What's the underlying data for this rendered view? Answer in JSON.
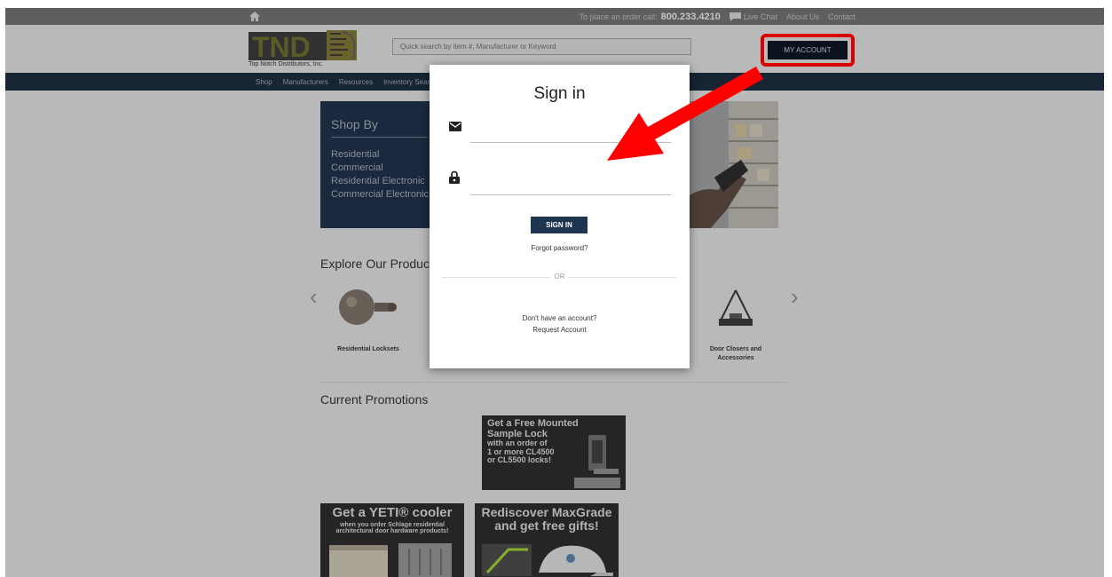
{
  "topbar": {
    "order_text": "To place an order call:",
    "phone": "800.233.4210",
    "live_chat": "Live Chat",
    "about": "About Us",
    "contact": "Contact"
  },
  "header": {
    "logo_text": "TND",
    "logo_subtitle": "Top Notch Distributors, Inc.",
    "search_placeholder": "Quick search by item #, Manufacturer or Keyword",
    "account_button": "MY ACCOUNT"
  },
  "nav": {
    "items": [
      "Shop",
      "Manufacturers",
      "Resources",
      "Inventory Search"
    ]
  },
  "shop_by": {
    "title": "Shop By",
    "items": [
      "Residential",
      "Commercial",
      "Residential Electronic",
      "Commercial Electronic"
    ]
  },
  "explore": {
    "title": "Explore Our Products",
    "products": [
      "Residential Locksets",
      "Door Closers and Accessories"
    ]
  },
  "promotions": {
    "title": "Current Promotions",
    "promo1": [
      "Get a Free Mounted",
      "Sample Lock",
      "with an order of",
      "1 or more CL4500",
      "or CL5500 locks!"
    ],
    "promo2_title": "Get a YETI® cooler",
    "promo2_sub": [
      "when you order Schlage residential",
      "architectural door hardware products!"
    ],
    "promo3": [
      "Rediscover MaxGrade",
      "and get free gifts!"
    ]
  },
  "signin": {
    "title": "Sign in",
    "email_value": "",
    "password_value": "",
    "button": "SIGN IN",
    "forgot": "Forgot password?",
    "or": "OR",
    "no_account": "Don't have an account?",
    "request": "Request Account"
  },
  "colors": {
    "navy": "#1a2b3d",
    "button": "#1e3550",
    "highlight": "#ff0000"
  },
  "icons": [
    "home-icon",
    "chat-icon",
    "mail-icon",
    "lock-icon",
    "chevron-left-icon",
    "chevron-right-icon"
  ]
}
